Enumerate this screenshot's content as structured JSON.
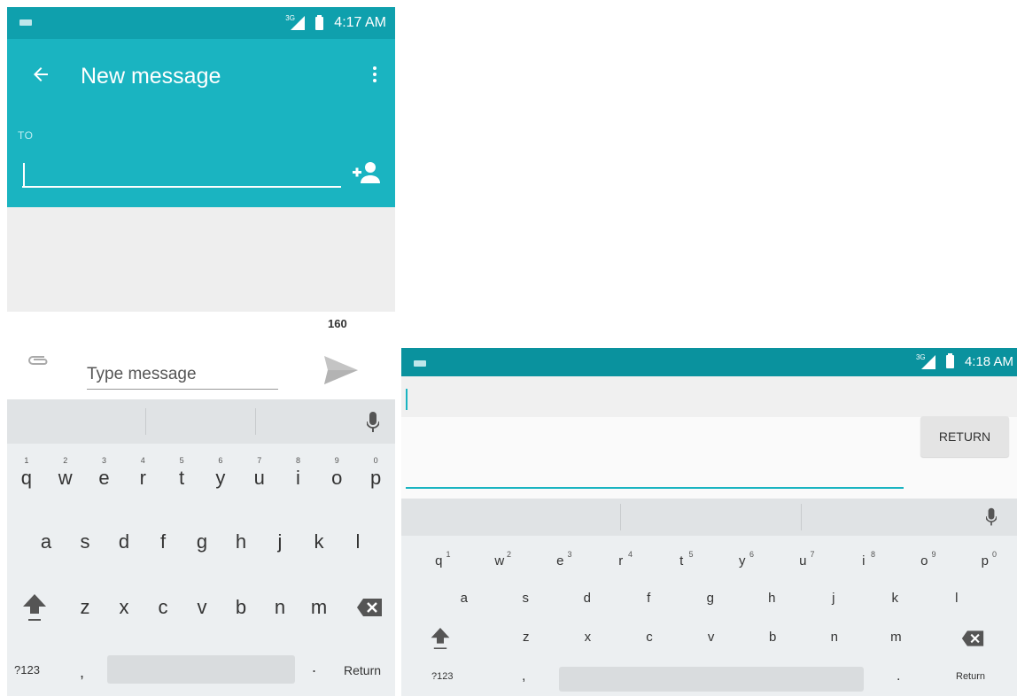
{
  "left": {
    "status": {
      "network": "3G",
      "time": "4:17 AM"
    },
    "appbar": {
      "title": "New message",
      "to_label": "TO"
    },
    "compose": {
      "char_counter": "160",
      "placeholder": "Type message"
    },
    "keyboard": {
      "row1": [
        "q",
        "w",
        "e",
        "r",
        "t",
        "y",
        "u",
        "i",
        "o",
        "p"
      ],
      "row1_hints": [
        "1",
        "2",
        "3",
        "4",
        "5",
        "6",
        "7",
        "8",
        "9",
        "0"
      ],
      "row2": [
        "a",
        "s",
        "d",
        "f",
        "g",
        "h",
        "j",
        "k",
        "l"
      ],
      "row3": [
        "z",
        "x",
        "c",
        "v",
        "b",
        "n",
        "m"
      ],
      "symbols_key": "?123",
      "comma_key": ",",
      "period_key": ".",
      "return_key": "Return"
    }
  },
  "right": {
    "status": {
      "network": "3G",
      "time": "4:18 AM"
    },
    "return_button": "RETURN",
    "keyboard": {
      "row1": [
        "q",
        "w",
        "e",
        "r",
        "t",
        "y",
        "u",
        "i",
        "o",
        "p"
      ],
      "row1_hints": [
        "1",
        "2",
        "3",
        "4",
        "5",
        "6",
        "7",
        "8",
        "9",
        "0"
      ],
      "row2": [
        "a",
        "s",
        "d",
        "f",
        "g",
        "h",
        "j",
        "k",
        "l"
      ],
      "row3": [
        "z",
        "x",
        "c",
        "v",
        "b",
        "n",
        "m"
      ],
      "symbols_key": "?123",
      "comma_key": ",",
      "period_key": ".",
      "return_key": "Return"
    }
  },
  "colors": {
    "teal": "#1ab4c1",
    "status_teal": "#0fa0ad",
    "keyboard_bg": "#eceff1"
  },
  "icons": [
    "back-arrow",
    "overflow-menu",
    "add-contact",
    "attach-clip",
    "send-arrow",
    "microphone",
    "shift",
    "backspace"
  ]
}
